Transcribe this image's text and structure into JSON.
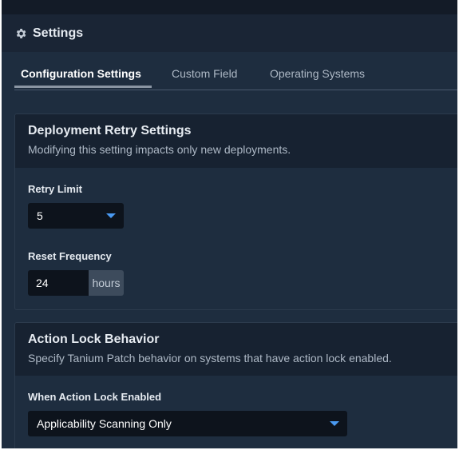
{
  "header": {
    "title": "Settings",
    "icon": "gear-icon"
  },
  "tabs": [
    {
      "label": "Configuration Settings",
      "active": true
    },
    {
      "label": "Custom Field",
      "active": false
    },
    {
      "label": "Operating Systems",
      "active": false
    }
  ],
  "deployment": {
    "title": "Deployment Retry Settings",
    "subtitle": "Modifying this setting impacts only new deployments.",
    "retry_limit_label": "Retry Limit",
    "retry_limit_value": "5",
    "reset_frequency_label": "Reset Frequency",
    "reset_frequency_value": "24",
    "reset_frequency_unit": "hours"
  },
  "action_lock": {
    "title": "Action Lock Behavior",
    "subtitle": "Specify Tanium Patch behavior on systems that have action lock enabled.",
    "field_label": "When Action Lock Enabled",
    "field_value": "Applicability Scanning Only"
  },
  "colors": {
    "accent": "#4a9af2",
    "background": "#1e2d3f",
    "header": "#1a2535",
    "input": "#0d131c"
  }
}
